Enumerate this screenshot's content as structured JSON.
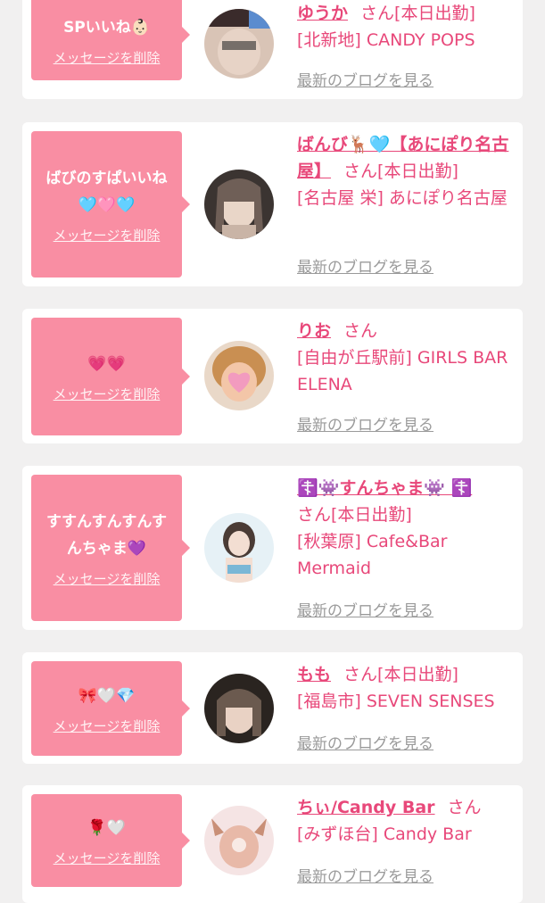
{
  "entries": [
    {
      "message": "SPいいね👶🏻",
      "delete_label": "メッセージを削除",
      "name": "ゆうか",
      "suffix": "さん",
      "status": "[本日出勤]",
      "shop": "[北新地] CANDY POPS",
      "blog_label": "最新のブログを見る",
      "avatar_colors": [
        "#3a2b2b",
        "#d9c4b6",
        "#a88f86"
      ]
    },
    {
      "message": "ばびのすぱいいね🩵🩷🩵",
      "delete_label": "メッセージを削除",
      "name": "ばんび🦌🩵【あにぽり名古屋】",
      "suffix": "さん",
      "status": "[本日出勤]",
      "shop": "[名古屋 栄] あにぽり名古屋",
      "blog_label": "最新のブログを見る",
      "avatar_colors": [
        "#3b3431",
        "#c9b4a6",
        "#6f5f57"
      ]
    },
    {
      "message": "💗💗",
      "delete_label": "メッセージを削除",
      "name": "りお",
      "suffix": "さん",
      "status": "",
      "shop": "[自由が丘駅前] GIRLS BAR ELENA",
      "blog_label": "最新のブログを見る",
      "avatar_colors": [
        "#c98f52",
        "#f3c6a8",
        "#f29bbf"
      ]
    },
    {
      "message": "すすんすんすんすんちゃま💜",
      "delete_label": "メッセージを削除",
      "name": "☦️👾すんちゃま👾 ☦️",
      "suffix": "さん",
      "status": "[本日出勤]",
      "shop": "[秋葉原] Cafe&Bar Mermaid",
      "blog_label": "最新のブログを見る",
      "avatar_colors": [
        "#e6f1f6",
        "#f3ded2",
        "#7ab7d6"
      ]
    },
    {
      "message": "🎀🤍💎",
      "delete_label": "メッセージを削除",
      "name": "もも",
      "suffix": "さん",
      "status": "[本日出勤]",
      "shop": "[福島市] SEVEN SENSES",
      "blog_label": "最新のブログを見る",
      "avatar_colors": [
        "#2a2420",
        "#e9d2c4",
        "#6b5a4f"
      ]
    },
    {
      "message": "🌹🤍",
      "delete_label": "メッセージを削除",
      "name": "ちぃ/Candy Bar",
      "suffix": "さん",
      "status": "",
      "shop": "[みずほ台] Candy Bar",
      "blog_label": "最新のブログを見る",
      "avatar_colors": [
        "#f5e4e4",
        "#e8b9a8",
        "#c98f77"
      ]
    }
  ]
}
